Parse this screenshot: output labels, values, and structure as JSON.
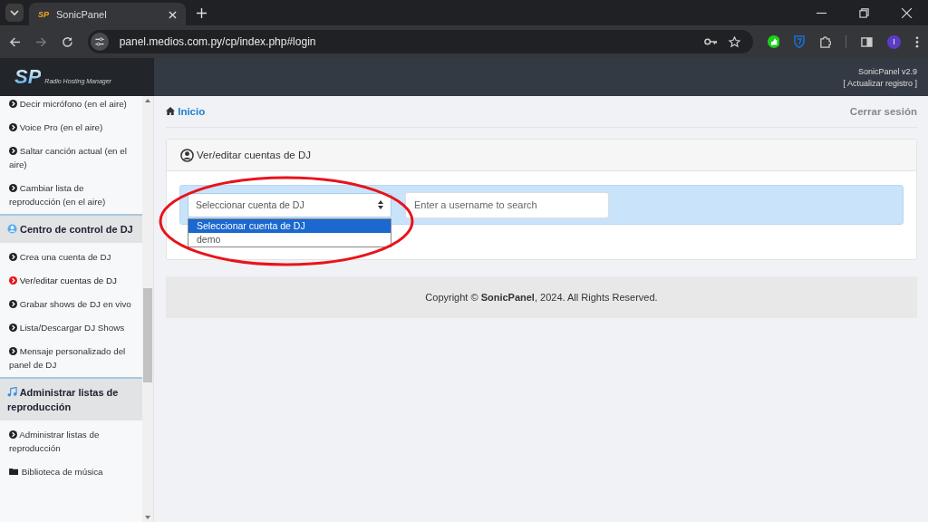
{
  "browser": {
    "tab": {
      "title": "SonicPanel",
      "favicon": "SP",
      "selected": true
    },
    "url": "panel.medios.com.py/cp/index.php#login",
    "avatar": "I"
  },
  "header": {
    "logo": "SP",
    "tagline": "Radio Hosting Manager",
    "version": "SonicPanel v2.9",
    "update_link": "[ Actualizar registro ]"
  },
  "sidebar": {
    "items": [
      {
        "kind": "item",
        "label": "Decir micrófono (en el aire)",
        "selected": false
      },
      {
        "kind": "item",
        "label": "Voice Pro (en el aire)",
        "selected": false
      },
      {
        "kind": "item",
        "label": "Saltar canción actual (en el aire)",
        "selected": false
      },
      {
        "kind": "item",
        "label": "Cambiar lista de reproducción (en el aire)",
        "selected": false
      },
      {
        "kind": "section",
        "label": "Centro de control de DJ"
      },
      {
        "kind": "item",
        "label": "Crea una cuenta de DJ",
        "selected": false
      },
      {
        "kind": "item",
        "label": "Ver/editar cuentas de DJ",
        "selected": true
      },
      {
        "kind": "item",
        "label": "Grabar shows de DJ en vivo",
        "selected": false
      },
      {
        "kind": "item",
        "label": "Lista/Descargar DJ Shows",
        "selected": false
      },
      {
        "kind": "item",
        "label": "Mensaje personalizado del panel de DJ",
        "selected": false
      },
      {
        "kind": "section",
        "label": "Administrar listas de reproducción"
      },
      {
        "kind": "item",
        "label": "Administrar listas de reproducción",
        "selected": false
      },
      {
        "kind": "folder",
        "label": "Biblioteca de música",
        "selected": false
      }
    ]
  },
  "breadcrumb": "Inicio",
  "logout": "Cerrar sesión",
  "card": {
    "title": "Ver/editar cuentas de DJ",
    "select": {
      "value": "Seleccionar cuenta de DJ",
      "expanded": true,
      "options": [
        {
          "label": "Seleccionar cuenta de DJ",
          "selected": true
        },
        {
          "label": "demo",
          "selected": false
        }
      ]
    },
    "search": {
      "placeholder": "Enter a username to search"
    }
  },
  "annotation": {
    "kind": "ellipse",
    "color": "#e8141b"
  },
  "footer": {
    "text": "Copyright © **SonicPanel**, 2024. All Rights Reserved."
  }
}
